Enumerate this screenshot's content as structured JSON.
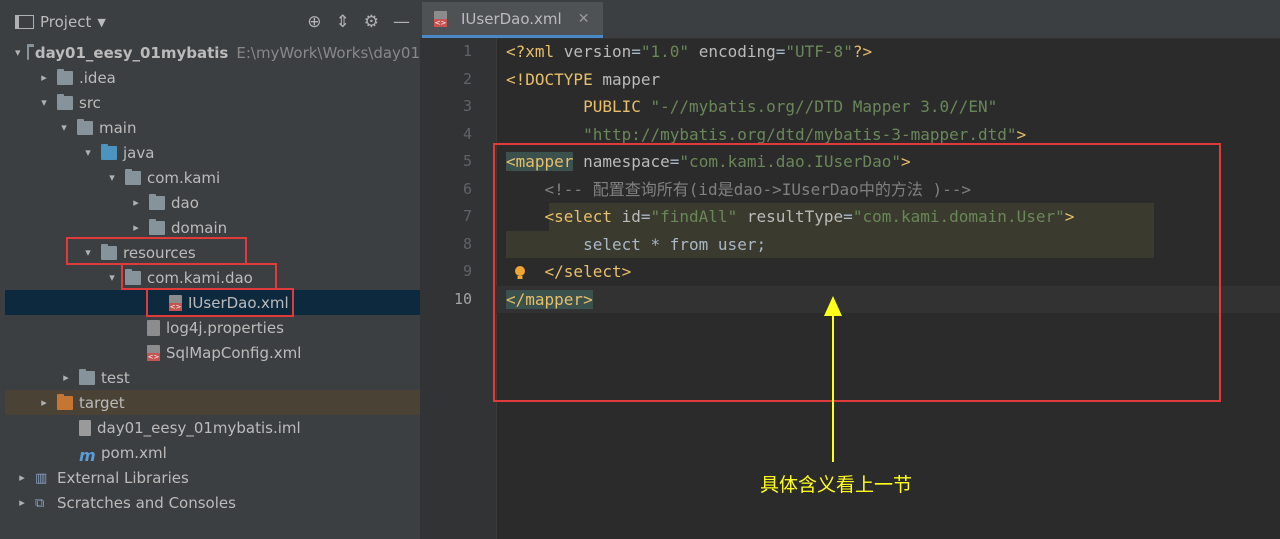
{
  "project_panel": {
    "title": "Project",
    "tree": [
      {
        "label": "day01_eesy_01mybatis",
        "path": "E:\\myWork\\Works\\day01",
        "arrow": "▾",
        "icon": "module-folder",
        "bold": true
      },
      {
        "label": ".idea",
        "arrow": "▸",
        "icon": "folder"
      },
      {
        "label": "src",
        "arrow": "▾",
        "icon": "folder"
      },
      {
        "label": "main",
        "arrow": "▾",
        "icon": "folder"
      },
      {
        "label": "java",
        "arrow": "▾",
        "icon": "source-folder"
      },
      {
        "label": "com.kami",
        "arrow": "▾",
        "icon": "package"
      },
      {
        "label": "dao",
        "arrow": "▸",
        "icon": "package"
      },
      {
        "label": "domain",
        "arrow": "▸",
        "icon": "package"
      },
      {
        "label": "resources",
        "arrow": "▾",
        "icon": "resources-folder"
      },
      {
        "label": "com.kami.dao",
        "arrow": "▾",
        "icon": "folder"
      },
      {
        "label": "IUserDao.xml",
        "arrow": "",
        "icon": "xml-file",
        "selected": true
      },
      {
        "label": "log4j.properties",
        "arrow": "",
        "icon": "properties-file"
      },
      {
        "label": "SqlMapConfig.xml",
        "arrow": "",
        "icon": "xml-file"
      },
      {
        "label": "test",
        "arrow": "▸",
        "icon": "folder"
      },
      {
        "label": "target",
        "arrow": "▸",
        "icon": "excluded-folder"
      },
      {
        "label": "day01_eesy_01mybatis.iml",
        "arrow": "",
        "icon": "iml-file"
      },
      {
        "label": "pom.xml",
        "arrow": "",
        "icon": "maven-icon"
      },
      {
        "label": "External Libraries",
        "arrow": "▸",
        "icon": "libraries-icon"
      },
      {
        "label": "Scratches and Consoles",
        "arrow": "▸",
        "icon": "scratches-icon"
      }
    ]
  },
  "editor": {
    "tab_label": "IUserDao.xml",
    "line_numbers": [
      "1",
      "2",
      "3",
      "4",
      "5",
      "6",
      "7",
      "8",
      "9",
      "10"
    ],
    "lines": [
      [
        {
          "t": "pi",
          "s": "<?xml "
        },
        {
          "t": "attr",
          "s": "version"
        },
        {
          "t": "text",
          "s": "="
        },
        {
          "t": "val",
          "s": "\"1.0\""
        },
        {
          "t": "text",
          "s": " "
        },
        {
          "t": "attr",
          "s": "encoding"
        },
        {
          "t": "text",
          "s": "="
        },
        {
          "t": "val",
          "s": "\"UTF-8\""
        },
        {
          "t": "pi",
          "s": "?>"
        }
      ],
      [
        {
          "t": "tag",
          "s": "<!DOCTYPE "
        },
        {
          "t": "attr",
          "s": "mapper"
        }
      ],
      [
        {
          "t": "text",
          "s": "        "
        },
        {
          "t": "tag",
          "s": "PUBLIC "
        },
        {
          "t": "val",
          "s": "\"-//mybatis.org//DTD Mapper 3.0//EN\""
        }
      ],
      [
        {
          "t": "text",
          "s": "        "
        },
        {
          "t": "val",
          "s": "\"http://mybatis.org/dtd/mybatis-3-mapper.dtd\""
        },
        {
          "t": "tag",
          "s": ">"
        }
      ],
      [
        {
          "t": "mtag",
          "s": "<mapper"
        },
        {
          "t": "text",
          "s": " "
        },
        {
          "t": "attr",
          "s": "namespace"
        },
        {
          "t": "text",
          "s": "="
        },
        {
          "t": "val",
          "s": "\"com.kami.dao.IUserDao\""
        },
        {
          "t": "tag",
          "s": ">"
        }
      ],
      [
        {
          "t": "text",
          "s": "    "
        },
        {
          "t": "comment",
          "s": "<!-- 配置查询所有(id是dao->IUserDao中的方法 )-->"
        }
      ],
      [
        {
          "t": "text",
          "s": "    "
        },
        {
          "t": "tag",
          "s": "<select "
        },
        {
          "t": "attr",
          "s": "id"
        },
        {
          "t": "text",
          "s": "="
        },
        {
          "t": "val",
          "s": "\"findAll\""
        },
        {
          "t": "text",
          "s": " "
        },
        {
          "t": "attr",
          "s": "resultType"
        },
        {
          "t": "text",
          "s": "="
        },
        {
          "t": "val",
          "s": "\"com.kami.domain.User\""
        },
        {
          "t": "tag",
          "s": ">"
        }
      ],
      [
        {
          "t": "text",
          "s": "        select * from user;"
        }
      ],
      [
        {
          "t": "text",
          "s": "    "
        },
        {
          "t": "tag",
          "s": "</select>"
        }
      ],
      [
        {
          "t": "mtag",
          "s": "</mapper"
        },
        {
          "t": "mtag",
          "s": ">"
        }
      ]
    ]
  },
  "annotation": {
    "text": "具体含义看上一节",
    "color": "#ffff1a"
  },
  "highlight_color": "#e03a3a"
}
